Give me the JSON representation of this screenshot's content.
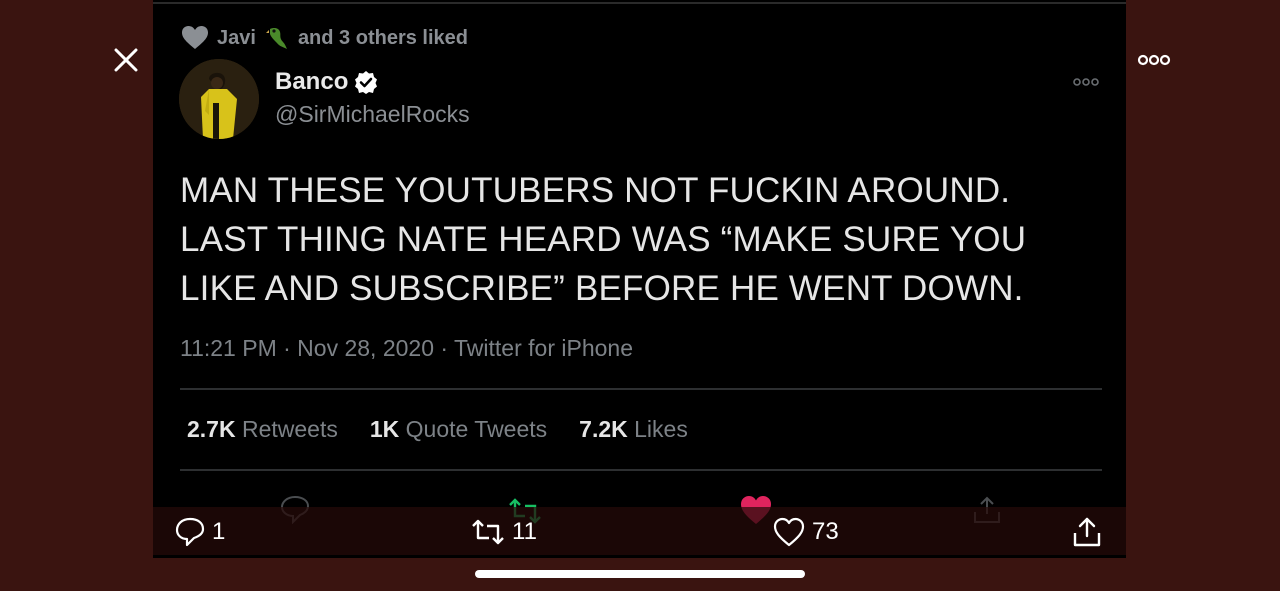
{
  "liked": {
    "name": "Javi",
    "text": "and 3 others liked"
  },
  "tweet": {
    "author": "Banco",
    "handle": "@SirMichaelRocks",
    "text": "MAN THESE YOUTUBERS NOT FUCKIN AROUND. LAST THING NATE HEARD WAS “MAKE SURE YOU LIKE AND SUBSCRIBE” BEFORE HE WENT DOWN.",
    "meta": "11:21 PM · Nov 28, 2020 · Twitter for iPhone"
  },
  "stats": {
    "retweets_count": "2.7K",
    "retweets_label": "Retweets",
    "quotes_count": "1K",
    "quotes_label": "Quote Tweets",
    "likes_count": "7.2K",
    "likes_label": "Likes"
  },
  "actions": {
    "reply_count": "1",
    "retweet_count": "11",
    "like_count": "73"
  },
  "colors": {
    "background": "#3a1410",
    "tweet_bg": "#000000",
    "verified_badge": "#ffffff",
    "retweet_green": "#17bf63",
    "like_pink": "#e0245e",
    "muted_text": "#7d8287"
  },
  "icons": [
    "close-icon",
    "more-icon",
    "heart-icon",
    "parrot-emoji-icon",
    "verified-icon",
    "reply-icon",
    "retweet-icon",
    "share-icon"
  ]
}
